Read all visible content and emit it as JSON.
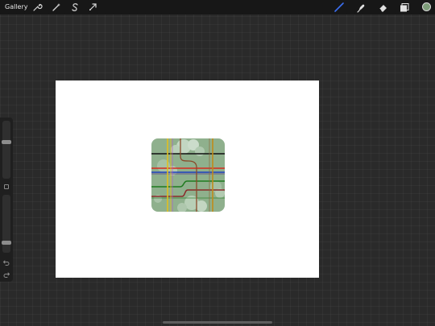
{
  "topbar": {
    "gallery_label": "Gallery",
    "left_tools": [
      "wrench-icon",
      "magic-wand-icon",
      "selection-s-icon",
      "transform-arrow-icon"
    ],
    "right_tools": [
      "brush-icon",
      "smudge-icon",
      "eraser-icon",
      "layers-icon"
    ],
    "active_tool": "brush-icon",
    "active_color": "#7d9c79"
  },
  "sidebar": {
    "brush_size": 0.36,
    "brush_opacity": 0.85,
    "buttons": [
      "modify-square-icon",
      "undo-icon",
      "redo-icon"
    ]
  },
  "canvas": {
    "background": "#ffffff",
    "artwork": {
      "background": "#8fb08d",
      "line_colors": [
        "#111111",
        "#d62b1e",
        "#1f3fbf",
        "#1f7a1f",
        "#8a4a2a",
        "#e0c020",
        "#c08a1a",
        "#b060c0"
      ]
    }
  },
  "colors": {
    "accent": "#3b6ff0",
    "toolbar_bg": "#171717",
    "workspace_bg": "#2a2a2a"
  }
}
